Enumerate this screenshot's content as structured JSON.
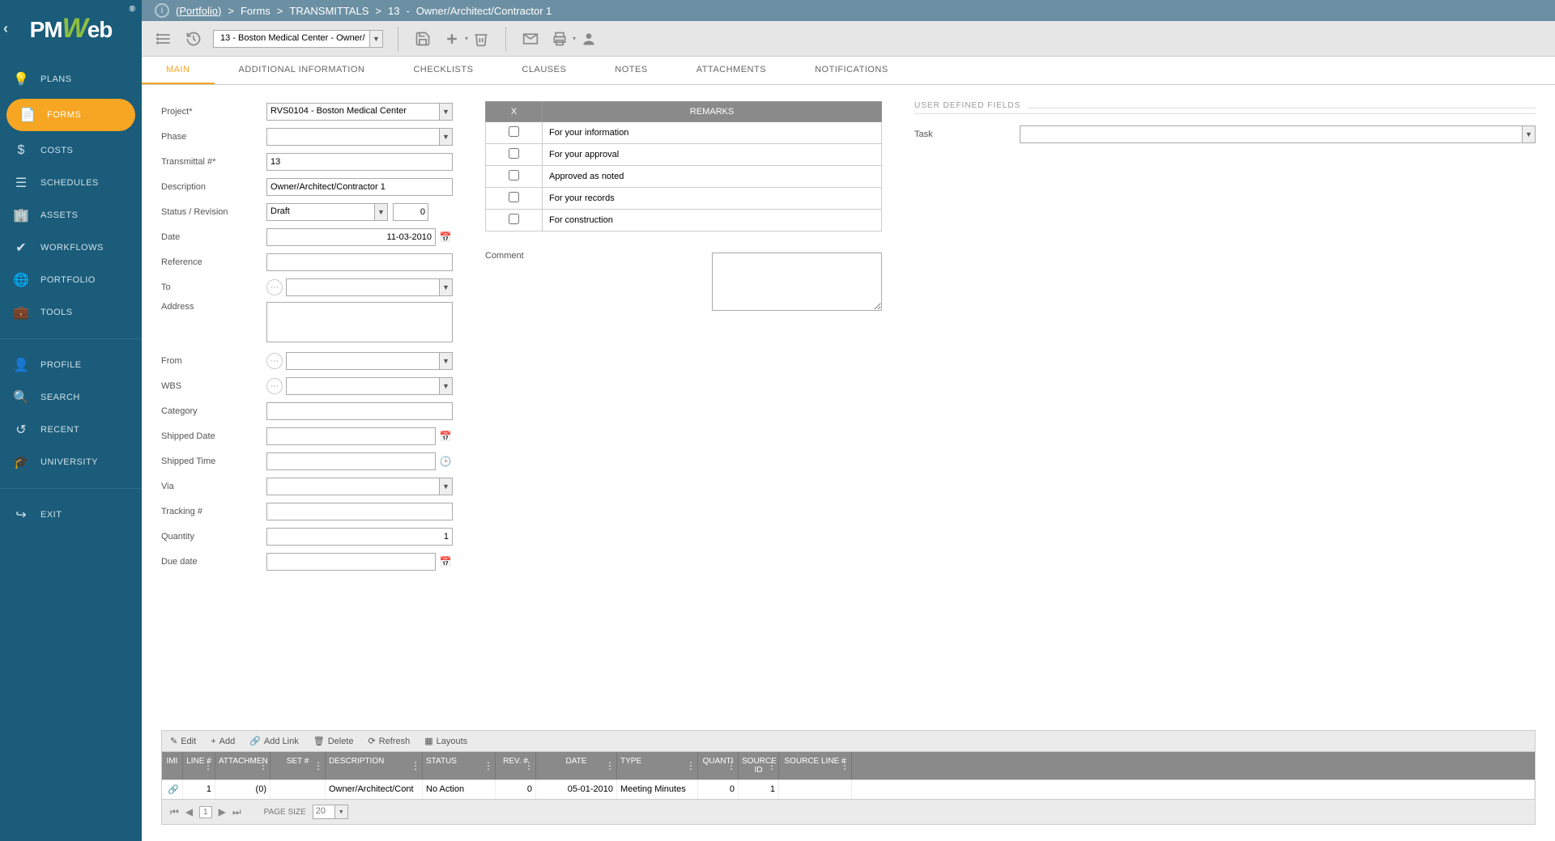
{
  "logo": {
    "prefix": "PM",
    "accent": "W",
    "suffix": "eb",
    "registered": "®"
  },
  "sidebar": {
    "items": [
      {
        "label": "PLANS",
        "icon": "lightbulb"
      },
      {
        "label": "FORMS",
        "icon": "document",
        "active": true
      },
      {
        "label": "COSTS",
        "icon": "dollar"
      },
      {
        "label": "SCHEDULES",
        "icon": "bars"
      },
      {
        "label": "ASSETS",
        "icon": "building"
      },
      {
        "label": "WORKFLOWS",
        "icon": "check"
      },
      {
        "label": "PORTFOLIO",
        "icon": "globe"
      },
      {
        "label": "TOOLS",
        "icon": "briefcase"
      }
    ],
    "items2": [
      {
        "label": "PROFILE",
        "icon": "person"
      },
      {
        "label": "SEARCH",
        "icon": "search"
      },
      {
        "label": "RECENT",
        "icon": "history"
      },
      {
        "label": "UNIVERSITY",
        "icon": "grad"
      }
    ],
    "items3": [
      {
        "label": "EXIT",
        "icon": "exit"
      }
    ]
  },
  "breadcrumb": {
    "portfolio": "(Portfolio)",
    "sep": ">",
    "forms": "Forms",
    "transmittals": "TRANSMITTALS",
    "id": "13",
    "title": "Owner/Architect/Contractor 1"
  },
  "toolbar": {
    "record_selector": "13 - Boston Medical Center - Owner/"
  },
  "tabs": [
    "MAIN",
    "ADDITIONAL INFORMATION",
    "CHECKLISTS",
    "CLAUSES",
    "NOTES",
    "ATTACHMENTS",
    "NOTIFICATIONS"
  ],
  "form": {
    "project_label": "Project*",
    "project_value": "RVS0104 - Boston Medical Center",
    "phase_label": "Phase",
    "phase_value": "",
    "transmittal_label": "Transmittal #*",
    "transmittal_value": "13",
    "description_label": "Description",
    "description_value": "Owner/Architect/Contractor 1",
    "status_label": "Status / Revision",
    "status_value": "Draft",
    "revision_value": "0",
    "date_label": "Date",
    "date_value": "11-03-2010",
    "reference_label": "Reference",
    "reference_value": "",
    "to_label": "To",
    "to_value": "",
    "address_label": "Address",
    "address_value": "",
    "from_label": "From",
    "from_value": "",
    "wbs_label": "WBS",
    "wbs_value": "",
    "category_label": "Category",
    "category_value": "",
    "shipped_date_label": "Shipped Date",
    "shipped_date_value": "",
    "shipped_time_label": "Shipped Time",
    "shipped_time_value": "",
    "via_label": "Via",
    "via_value": "",
    "tracking_label": "Tracking #",
    "tracking_value": "",
    "quantity_label": "Quantity",
    "quantity_value": "1",
    "due_date_label": "Due date",
    "due_date_value": ""
  },
  "remarks": {
    "header_x": "X",
    "header_remarks": "REMARKS",
    "rows": [
      "For your information",
      "For your approval",
      "Approved as noted",
      "For your records",
      "For construction"
    ]
  },
  "comment_label": "Comment",
  "udf": {
    "header": "USER DEFINED FIELDS",
    "task_label": "Task"
  },
  "grid": {
    "toolbar": {
      "edit": "Edit",
      "add": "Add",
      "add_link": "Add Link",
      "delete": "Delete",
      "refresh": "Refresh",
      "layouts": "Layouts"
    },
    "headers": {
      "img": "IMI",
      "line": "LINE #",
      "attachments": "ATTACHMEN",
      "set": "SET #",
      "description": "DESCRIPTION",
      "status": "STATUS",
      "rev": "REV. #",
      "date": "DATE",
      "type": "TYPE",
      "quantity": "QUANTI",
      "source_id": "SOURCE ID",
      "source_line": "SOURCE LINE #"
    },
    "row": {
      "line": "1",
      "attachments": "(0)",
      "set": "",
      "description": "Owner/Architect/Cont",
      "status": "No Action",
      "rev": "0",
      "date": "05-01-2010",
      "type": "Meeting Minutes",
      "quantity": "0",
      "source_id": "1",
      "source_line": ""
    },
    "pager": {
      "page": "1",
      "page_size_label": "PAGE SIZE",
      "page_size": "20"
    }
  }
}
